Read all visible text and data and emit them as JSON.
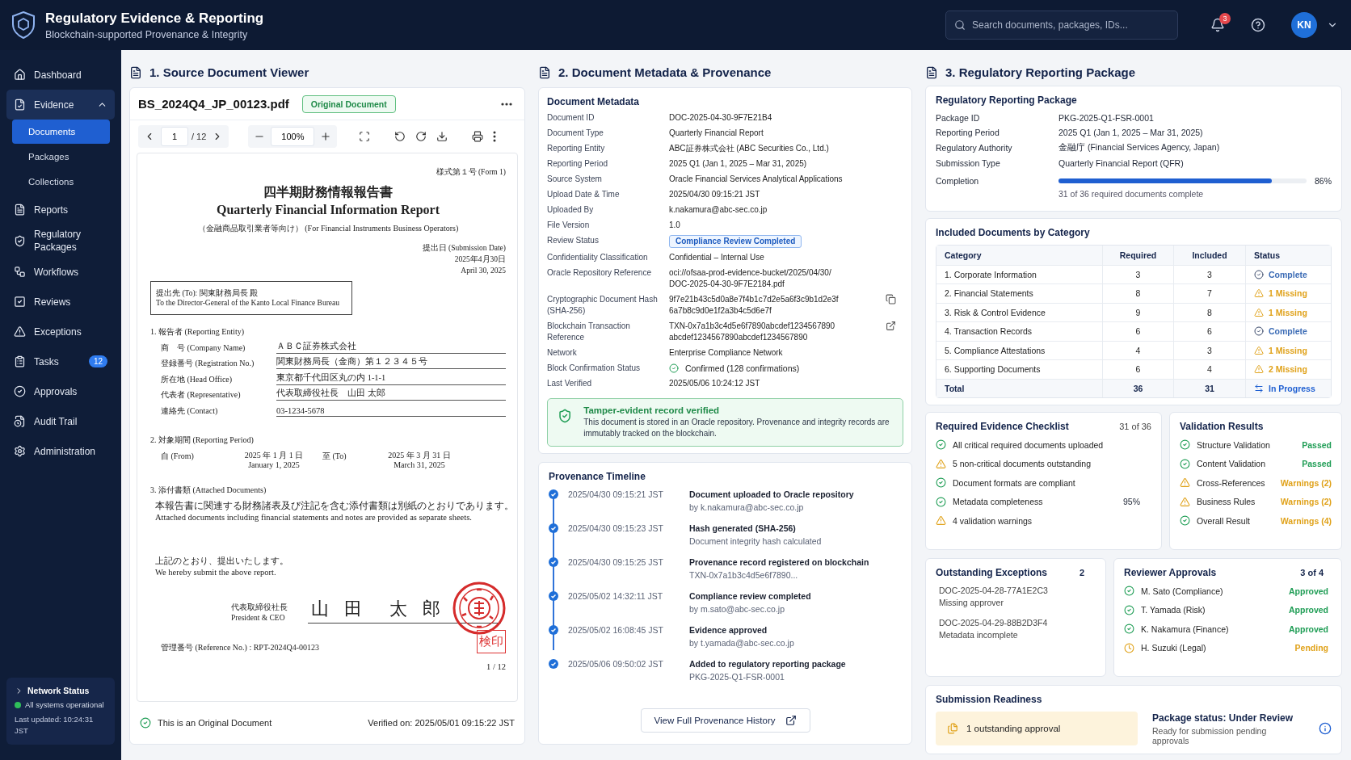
{
  "header": {
    "title": "Regulatory Evidence & Reporting",
    "subtitle": "Blockchain-supported Provenance & Integrity",
    "search_placeholder": "Search documents, packages, IDs...",
    "notifications": "3",
    "avatar": "KN"
  },
  "sidebar": {
    "items": [
      {
        "label": "Dashboard",
        "selected": false
      },
      {
        "label": "Evidence",
        "selected": true,
        "expanded": true,
        "children": [
          {
            "label": "Documents",
            "selected": true
          },
          {
            "label": "Packages",
            "selected": false
          },
          {
            "label": "Collections",
            "selected": false
          }
        ]
      },
      {
        "label": "Reports",
        "selected": false
      },
      {
        "label": "Regulatory Packages",
        "selected": false
      },
      {
        "label": "Workflows",
        "selected": false
      },
      {
        "label": "Reviews",
        "selected": false
      },
      {
        "label": "Exceptions",
        "selected": false
      },
      {
        "label": "Tasks",
        "selected": false,
        "badge": "12"
      },
      {
        "label": "Approvals",
        "selected": false
      },
      {
        "label": "Audit Trail",
        "selected": false
      },
      {
        "label": "Administration",
        "selected": false
      }
    ],
    "network_status": {
      "title": "Network Status",
      "status": "All systems operational",
      "updated": "Last updated: 10:24:31 JST"
    }
  },
  "viewer": {
    "heading": "1. Source Document Viewer",
    "filename": "BS_2024Q4_JP_00123.pdf",
    "badge": "Original Document",
    "page": "1",
    "pages": "/ 12",
    "zoom": "100%",
    "document": {
      "form_no": "様式第１号 (Form 1)",
      "title_ja": "四半期財務情報報告書",
      "title_en": "Quarterly Financial Information Report",
      "subtitle": "（金融商品取引業者等向け） (For Financial Instruments Business Operators)",
      "submission_label": "提出日 (Submission Date)",
      "date_ja": "2025年4月30日",
      "date_en": "April 30, 2025",
      "to_ja": "提出先 (To): 関東財務局長 殿",
      "to_en": "To the Director-General of the Kanto Local Finance Bureau",
      "entity_heading": "1. 報告者 (Reporting Entity)",
      "fields": [
        {
          "label": "商　号 (Company Name)",
          "value": "ＡＢＣ証券株式会社"
        },
        {
          "label": "登録番号 (Registration No.)",
          "value": "関東財務局長（金商）第１２３４５号"
        },
        {
          "label": "所在地 (Head Office)",
          "value": "東京都千代田区丸の内 1-1-1"
        },
        {
          "label": "代表者 (Representative)",
          "value": "代表取締役社長　山田 太郎"
        },
        {
          "label": "連絡先 (Contact)",
          "value": "03-1234-5678"
        }
      ],
      "period_heading": "2. 対象期間 (Reporting Period)",
      "from_label": "自 (From)",
      "from_ja": "2025 年 1 月 1 日",
      "from_en": "January 1, 2025",
      "to_label": "至 (To)",
      "to_date_ja": "2025 年 3 月 31 日",
      "to_date_en": "March 31, 2025",
      "attached_heading": "3. 添付書類 (Attached Documents)",
      "attached_ja": "本報告書に関連する財務諸表及び注記を含む添付書類は別紙のとおりであります。",
      "attached_en": "Attached documents including financial statements and notes are provided as separate sheets.",
      "closing_ja": "上記のとおり、提出いたします。",
      "closing_en": "We hereby submit the above report.",
      "signer_ja": "代表取締役社長",
      "signer_en": "President & CEO",
      "signature": "山 田　太 郎",
      "check_seal": "検印",
      "reference": "管理番号 (Reference No.) : RPT-2024Q4-00123",
      "page_no": "1 / 12"
    },
    "footer_note": "This is an Original Document",
    "verified": "Verified on: 2025/05/01 09:15:22 JST"
  },
  "metadata": {
    "heading": "2. Document Metadata & Provenance",
    "title": "Document Metadata",
    "rows": [
      {
        "label": "Document ID",
        "kind": "text",
        "value": [
          "DOC-2025-04-30-9F7E21B4"
        ]
      },
      {
        "label": "Document Type",
        "kind": "text",
        "value": [
          "Quarterly Financial Report"
        ]
      },
      {
        "label": "Reporting Entity",
        "kind": "text",
        "value": [
          "ABC証券株式会社 (ABC Securities Co., Ltd.)"
        ]
      },
      {
        "label": "Reporting Period",
        "kind": "text",
        "value": [
          "2025 Q1 (Jan 1, 2025 – Mar 31, 2025)"
        ]
      },
      {
        "label": "Source System",
        "kind": "text",
        "value": [
          "Oracle Financial Services Analytical Applications"
        ]
      },
      {
        "label": "Upload Date & Time",
        "kind": "text",
        "value": [
          "2025/04/30 09:15:21 JST"
        ]
      },
      {
        "label": "Uploaded By",
        "kind": "text",
        "value": [
          "k.nakamura@abc-sec.co.jp"
        ]
      },
      {
        "label": "File Version",
        "kind": "text",
        "value": [
          "1.0"
        ]
      },
      {
        "label": "Review Status",
        "kind": "badge",
        "value": [
          "Compliance Review Completed"
        ]
      },
      {
        "label": "Confidentiality Classification",
        "kind": "text",
        "value": [
          "Confidential – Internal Use"
        ]
      },
      {
        "label": "Oracle Repository Reference",
        "kind": "text",
        "value": [
          "oci://ofsaa-prod-evidence-bucket/2025/04/30/",
          "DOC-2025-04-30-9F7E2184.pdf"
        ]
      },
      {
        "label": "Cryptographic Document Hash (SHA-256)",
        "kind": "copy",
        "value": [
          "9f7e21b43c5d0a8e7f4b1c7d2e5a6f3c9b1d2e3f",
          "6a7b8c9d0e1f2a3b4c5d6e7f"
        ]
      },
      {
        "label": "Blockchain Transaction Reference",
        "kind": "link",
        "value": [
          "TXN-0x7a1b3c4d5e6f7890abcdef1234567890",
          "abcdef1234567890abcdef1234567890"
        ]
      },
      {
        "label": "Network",
        "kind": "text",
        "value": [
          "Enterprise Compliance Network"
        ]
      },
      {
        "label": "Block Confirmation Status",
        "kind": "confirmed",
        "value": [
          "Confirmed (128 confirmations)"
        ]
      },
      {
        "label": "Last Verified",
        "kind": "text",
        "value": [
          "2025/05/06 10:24:12 JST"
        ]
      }
    ],
    "notice": {
      "title": "Tamper-evident record verified",
      "text": "This document is stored in an Oracle repository. Provenance and integrity records are immutably tracked on the blockchain."
    }
  },
  "timeline": {
    "title": "Provenance Timeline",
    "events": [
      {
        "time": "2025/04/30 09:15:21 JST",
        "title": "Document uploaded to Oracle repository",
        "detail": "by k.nakamura@abc-sec.co.jp"
      },
      {
        "time": "2025/04/30 09:15:23 JST",
        "title": "Hash generated (SHA-256)",
        "detail": "Document integrity hash calculated"
      },
      {
        "time": "2025/04/30 09:15:25 JST",
        "title": "Provenance record registered on blockchain",
        "detail": "TXN-0x7a1b3c4d5e6f7890..."
      },
      {
        "time": "2025/05/02 14:32:11 JST",
        "title": "Compliance review completed",
        "detail": "by m.sato@abc-sec.co.jp"
      },
      {
        "time": "2025/05/02 16:08:45 JST",
        "title": "Evidence approved",
        "detail": "by t.yamada@abc-sec.co.jp"
      },
      {
        "time": "2025/05/06 09:50:02 JST",
        "title": "Added to regulatory reporting package",
        "detail": "PKG-2025-Q1-FSR-0001"
      }
    ],
    "button": "View Full Provenance History"
  },
  "package": {
    "heading": "3. Regulatory Reporting Package",
    "title": "Regulatory Reporting Package",
    "rows": [
      {
        "label": "Package ID",
        "value": "PKG-2025-Q1-FSR-0001"
      },
      {
        "label": "Reporting Period",
        "value": "2025 Q1 (Jan 1, 2025 – Mar 31, 2025)"
      },
      {
        "label": "Regulatory Authority",
        "value": "金融庁 (Financial Services Agency, Japan)"
      },
      {
        "label": "Submission Type",
        "value": "Quarterly Financial Report (QFR)"
      }
    ],
    "completion": {
      "label": "Completion",
      "level": 0.86,
      "reading": "86%",
      "note": "31 of 36 required documents complete"
    }
  },
  "categories": {
    "title": "Included Documents by Category",
    "columns": [
      "Category",
      "Required",
      "Included",
      "Status"
    ],
    "rows": [
      {
        "category": "1. Corporate Information",
        "required": "3",
        "included": "3",
        "status": "Complete",
        "kind": "complete"
      },
      {
        "category": "2. Financial Statements",
        "required": "8",
        "included": "7",
        "status": "1 Missing",
        "kind": "missing"
      },
      {
        "category": "3. Risk & Control Evidence",
        "required": "9",
        "included": "8",
        "status": "1 Missing",
        "kind": "missing"
      },
      {
        "category": "4. Transaction Records",
        "required": "6",
        "included": "6",
        "status": "Complete",
        "kind": "complete"
      },
      {
        "category": "5. Compliance Attestations",
        "required": "4",
        "included": "3",
        "status": "1 Missing",
        "kind": "missing"
      },
      {
        "category": "6. Supporting Documents",
        "required": "6",
        "included": "4",
        "status": "2 Missing",
        "kind": "missing"
      },
      {
        "category": "Total",
        "required": "36",
        "included": "31",
        "status": "In Progress",
        "kind": "total"
      }
    ]
  },
  "checklist": {
    "title": "Required Evidence Checklist",
    "count": "31 of 36",
    "items": [
      {
        "text": "All critical required documents uploaded",
        "kind": "ok"
      },
      {
        "text": "5 non-critical documents outstanding",
        "kind": "warn"
      },
      {
        "text": "Document formats are compliant",
        "kind": "ok"
      },
      {
        "text": "Metadata completeness",
        "kind": "ok",
        "value": "95%"
      },
      {
        "text": "4 validation warnings",
        "kind": "warn"
      }
    ]
  },
  "validation": {
    "title": "Validation Results",
    "items": [
      {
        "label": "Structure Validation",
        "kind": "ok",
        "result": "Passed",
        "passed": true
      },
      {
        "label": "Content Validation",
        "kind": "ok",
        "result": "Passed",
        "passed": true
      },
      {
        "label": "Cross-References",
        "kind": "warn",
        "result": "Warnings (2)",
        "passed": false
      },
      {
        "label": "Business Rules",
        "kind": "warn",
        "result": "Warnings (2)",
        "passed": false
      },
      {
        "label": "Overall Result",
        "kind": "ok",
        "result": "Warnings (4)",
        "passed": false
      }
    ]
  },
  "exceptions": {
    "title": "Outstanding Exceptions",
    "count": "2",
    "items": [
      {
        "id": "DOC-2025-04-28-77A1E2C3",
        "reason": "Missing approver"
      },
      {
        "id": "DOC-2025-04-29-88B2D3F4",
        "reason": "Metadata incomplete"
      }
    ]
  },
  "approvals": {
    "title": "Reviewer Approvals",
    "count": "3 of 4",
    "items": [
      {
        "name": "M. Sato (Compliance)",
        "status": "Approved",
        "kind": "approved"
      },
      {
        "name": "T. Yamada (Risk)",
        "status": "Approved",
        "kind": "approved"
      },
      {
        "name": "K. Nakamura (Finance)",
        "status": "Approved",
        "kind": "approved"
      },
      {
        "name": "H. Suzuki (Legal)",
        "status": "Pending",
        "kind": "pending"
      }
    ]
  },
  "readiness": {
    "title": "Submission Readiness",
    "alert": "1 outstanding approval",
    "status_title": "Package status: Under Review",
    "status_text": "Ready for submission pending approvals"
  }
}
